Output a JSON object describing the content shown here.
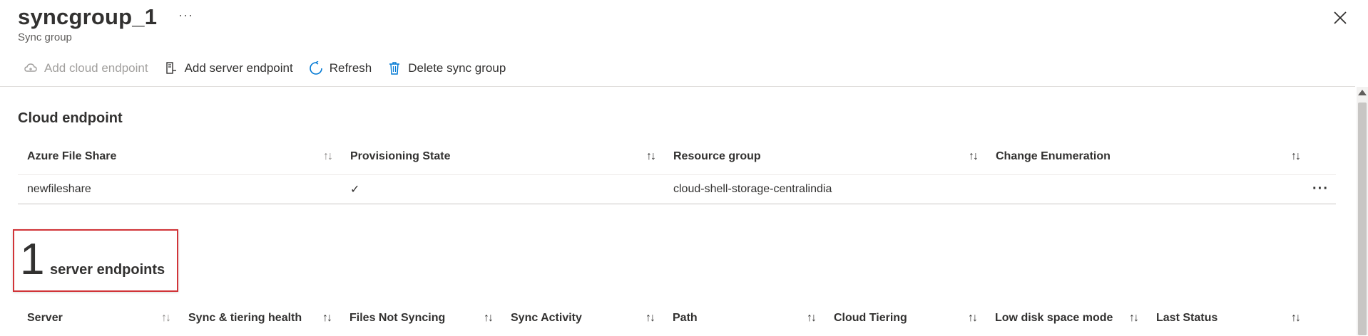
{
  "header": {
    "title": "syncgroup_1",
    "more": "···",
    "subtitle": "Sync group"
  },
  "toolbar": {
    "add_cloud_endpoint": "Add cloud endpoint",
    "add_server_endpoint": "Add server endpoint",
    "refresh": "Refresh",
    "delete_sync_group": "Delete sync group"
  },
  "cloud_endpoint": {
    "section_title": "Cloud endpoint",
    "columns": [
      "Azure File Share",
      "Provisioning State",
      "Resource group",
      "Change Enumeration"
    ],
    "rows": [
      {
        "azure_file_share": "newfileshare",
        "provisioning_state": "✓",
        "resource_group": "cloud-shell-storage-centralindia",
        "change_enumeration": ""
      }
    ],
    "row_more": "···"
  },
  "server_endpoints": {
    "count": "1",
    "label": "server endpoints",
    "columns": [
      "Server",
      "Sync & tiering health",
      "Files Not Syncing",
      "Sync Activity",
      "Path",
      "Cloud Tiering",
      "Low disk space mode",
      "Last Status"
    ]
  },
  "sort_glyph": "↑↓",
  "colors": {
    "highlight_border": "#d13438",
    "accent": "#0078d4"
  }
}
